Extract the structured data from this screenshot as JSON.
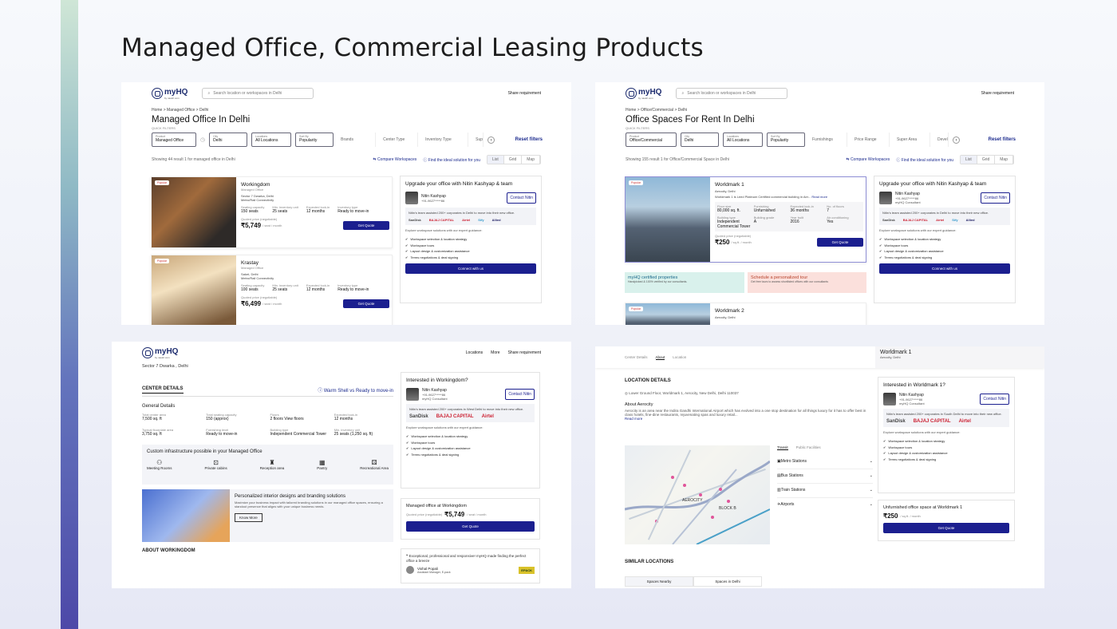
{
  "page_title": "Managed Office, Commercial Leasing Products",
  "brand": {
    "logo": "myHQ",
    "logo_sub": "by naukri.com",
    "share": "Share requirement"
  },
  "panel1": {
    "search_placeholder": "Search location or workspaces in Delhi",
    "breadcrumb": "Home  >  Managed Office  >  Delhi",
    "heading": "Managed Office In Delhi",
    "quick_filters": "QUICK FILTERS",
    "filters": [
      {
        "label": "Product",
        "value": "Managed Office"
      },
      {
        "label": "City",
        "value": "Delhi"
      },
      {
        "label": "Locations",
        "value": "All Locations"
      },
      {
        "label": "Sort By",
        "value": "Popularity"
      }
    ],
    "plain_filters": [
      "Brands",
      "Center Type",
      "Inventory Type",
      "Sup"
    ],
    "reset": "Reset filters",
    "showing": "Showing 44 result 1 for managed office in Delhi",
    "compare": "Compare Workspaces",
    "find": "Find the ideal solution for you",
    "views": [
      "List",
      "Grid",
      "Map"
    ],
    "listings": [
      {
        "badge": "Popular",
        "name": "Workingdom",
        "type": "Managed Office",
        "address": "Sector 7 Dwarka, Delhi",
        "conn": "Metro/Rail Connectivity",
        "seat_label": "Seating capacity",
        "seat": "150 seats",
        "min_label": "Min. inventory unit",
        "min": "25 seats",
        "lock_label": "Expected lock-in",
        "lock": "12 months",
        "inv_label": "Inventory type",
        "inv": "Ready to move-in",
        "quoted": "Quoted price (negotiable)",
        "price": "₹5,749",
        "per": "/ seat / month",
        "cta": "Get Quote"
      },
      {
        "badge": "Popular",
        "name": "Krastay",
        "type": "Managed Office",
        "address": "Saket, Delhi",
        "conn": "Metro/Rail Connectivity",
        "seat_label": "Seating capacity",
        "seat": "100 seats",
        "min_label": "Min. inventory unit",
        "min": "25 seats",
        "lock_label": "Expected lock-in",
        "lock": "12 months",
        "inv_label": "Inventory type",
        "inv": "Ready to move-in",
        "quoted": "Quoted price (negotiable)",
        "price": "₹6,499",
        "per": "/ seat / month",
        "cta": "Get Quote"
      }
    ],
    "advisor": {
      "title": "Upgrade your office with Nitin Kashyap & team",
      "name": "Nitin Kashyap",
      "phone": "+91-9627*****86",
      "contact": "Contact Nitin",
      "note": "Nitin's team assisted 200+ corporates in Delhi to move into their new office.",
      "guide": "Explore workspace solutions with our expert guidance:",
      "points": [
        "Workspace selection & location strategy",
        "Workspace tours",
        "Layout design & customization assistance",
        "Terms negotiations & deal signing"
      ],
      "cta": "Connect with us",
      "logos": [
        "SanDisk",
        "BAJAJ CAPITAL",
        "Airtel",
        "Sify",
        "Allied"
      ]
    }
  },
  "panel2": {
    "search_placeholder": "Search location or workspaces in Delhi",
    "breadcrumb": "Home  >  Office/Commercial  >  Delhi",
    "heading": "Office Spaces For Rent In Delhi",
    "quick_filters": "QUICK FILTERS",
    "filters": [
      {
        "label": "Product",
        "value": "Office/Commercial"
      },
      {
        "label": "City",
        "value": "Delhi"
      },
      {
        "label": "Locations",
        "value": "All Locations"
      },
      {
        "label": "Sort By",
        "value": "Popularity"
      }
    ],
    "plain_filters": [
      "Furnishings",
      "Price Range",
      "Super Area",
      "Devel"
    ],
    "reset": "Reset filters",
    "showing": "Showing 155 result 1 for Office/Commercial Space in Delhi",
    "compare": "Compare Workspaces",
    "find": "Find the ideal solution for you",
    "views": [
      "List",
      "Grid",
      "Map"
    ],
    "listing": {
      "badge": "Popular",
      "name": "Worldmark 1",
      "address": "Aerocity, Delhi",
      "desc": "Worldmark 1 is Leed Platinum Certified commercial building in Aer...",
      "more": "Read more",
      "floor_label": "Floor size",
      "floor": "80,000 sq. ft.",
      "furn_label": "Furnishing",
      "furn": "Unfurnished",
      "lock_label": "Expected lock-in",
      "lock": "36 months",
      "floors_label": "No. of floors",
      "floors": "7",
      "btype_label": "Building type",
      "btype": "Independent Commercial Tower",
      "grade_label": "Building grade",
      "grade": "A",
      "year_label": "Year built",
      "year": "2016",
      "ac_label": "Air conditioning",
      "ac": "Yes",
      "quoted": "Quoted price (negotiable)",
      "price": "₹250",
      "per": "/ sq.ft. / month",
      "cta": "Get Quote"
    },
    "promo1": {
      "title": "myHQ certified properties",
      "sub": "Handpicked & 100% verified by our consultants."
    },
    "promo2": {
      "title": "Schedule a personalized tour",
      "sub": "Get free tours to assess shortlisted offices with our consultants"
    },
    "listing2": {
      "badge": "Popular",
      "name": "Worldmark 2",
      "address": "Aerocity, Delhi"
    },
    "advisor": {
      "title": "Upgrade your office with Nitin Kashyap & team",
      "name": "Nitin Kashyap",
      "phone": "+91-9627*****86",
      "role": "myHQ Consultant",
      "contact": "Contact Nitin",
      "note": "Nitin's team assisted 200+ corporates in Delhi to move into their new office.",
      "guide": "Explore workspace solutions with our expert guidance:",
      "points": [
        "Workspace selection & location strategy",
        "Workspace tours",
        "Layout design & customization assistance",
        "Terms negotiations & deal signing"
      ],
      "cta": "Connect with us",
      "logos": [
        "SanDisk",
        "BAJAJ CAPITAL",
        "Airtel",
        "Sify",
        "Allied"
      ]
    }
  },
  "panel3": {
    "nav": [
      "Locations",
      "More",
      "Share requirement"
    ],
    "location": "Sector 7 Dwarka , Delhi",
    "center_details": "CENTER DETAILS",
    "warm": "Warm Shell vs Ready to move-in",
    "general": "General Details",
    "details": [
      {
        "k": "Total center area",
        "v": "7,500 sq. ft"
      },
      {
        "k": "Total seating capacity",
        "v": "150 (approx)"
      },
      {
        "k": "Floors",
        "v": "2 floors View floors"
      },
      {
        "k": "Expected lock-in",
        "v": "12 months"
      },
      {
        "k": "Typical floorplate area",
        "v": "3,750 sq. ft"
      },
      {
        "k": "Furnishing level",
        "v": "Ready to move-in"
      },
      {
        "k": "Building type",
        "v": "Independent Commercial Tower"
      },
      {
        "k": "Min. inventory unit",
        "v": "25 seats (1,250 sq. ft)"
      }
    ],
    "custom_title": "Custom infrastructure possible in your Managed Office",
    "amenities": [
      "Meeting Rooms",
      "Private cabins",
      "Reception area",
      "Pantry",
      "Recreational Area"
    ],
    "interior_title": "Personalized interior designs and branding solutions",
    "interior_text": "Maximize your business impact with tailored branding solutions in our managed office spaces, ensuring a standout presence that aligns with your unique business needs.",
    "know_more": "Know More",
    "about": "ABOUT WORKINGDOM",
    "advisor": {
      "title": "Interested in Workingdom?",
      "name": "Nitin Kashyap",
      "phone": "+91-9627*****86",
      "role": "myHQ Consultant",
      "contact": "Contact Nitin",
      "note": "Nitin's team assisted 200+ corporates in West Delhi to move into their new office.",
      "guide": "Explore workspace solutions with our expert guidance:",
      "points": [
        "Workspace selection & location strategy",
        "Workspace tours",
        "Layout design & customization assistance",
        "Terms negotiations & deal signing"
      ],
      "logos": [
        "SanDisk",
        "BAJAJ CAPITAL",
        "Airtel"
      ]
    },
    "quote_title": "Managed office at Workingdom",
    "quoted": "Quoted price (negotiable)",
    "price": "₹5,749",
    "per": "/ seat / month",
    "cta": "Get Quote",
    "review": "Exceptional, professional and responsive! myHQ made finding the perfect office a breeze",
    "reviewer": "Vishal Popali",
    "reviewer_role": "Assistant Manager, E-pack",
    "reviewer_logo": "EPACK"
  },
  "panel4": {
    "tabs": [
      "Center Details",
      "About",
      "Location"
    ],
    "sticky_name": "Worldmark 1",
    "sticky_loc": "Aerocity, Delhi",
    "loc_details": "LOCATION DETAILS",
    "address": "Lower Ground Floor, Worldmark 1, Aerocity, New Delhi, Delhi 110037",
    "about_title": "About Aerocity",
    "about_text": "Aerocity is an area near the Indira Gandhi International Airport which has evolved into a one stop destination for all things luxury for it has to offer best in class hotels, fine-dine restaurants, rejuvenating spas and luxury retail...",
    "read_more": "Read more",
    "transit_tabs": [
      "Transit",
      "Public Facilities"
    ],
    "transit": [
      "Metro Stations",
      "Bus Stations",
      "Train Stations",
      "Airports"
    ],
    "map_labels": [
      "AEROCITY",
      "BLOCK B"
    ],
    "similar": "SIMILAR LOCATIONS",
    "similar_tabs": [
      "Spaces Nearby",
      "Spaces in Delhi"
    ],
    "advisor": {
      "title": "Interested in Worldmark 1?",
      "name": "Nitin Kashyap",
      "phone": "+91-9627*****86",
      "role": "myHQ Consultant",
      "contact": "Contact Nitin",
      "note": "Nitin's team assisted 200+ corporates in South Delhi to move into their new office.",
      "guide": "Explore workspace solutions with our expert guidance:",
      "points": [
        "Workspace selection & location strategy",
        "Workspace tours",
        "Layout design & customization assistance",
        "Terms negotiations & deal signing"
      ],
      "logos": [
        "SanDisk",
        "BAJAJ CAPITAL",
        "Airtel"
      ]
    },
    "quote_title": "Unfurnished office space at Worldmark 1",
    "price": "₹250",
    "per": "/ sq.ft. / month",
    "cta": "Get Quote"
  }
}
